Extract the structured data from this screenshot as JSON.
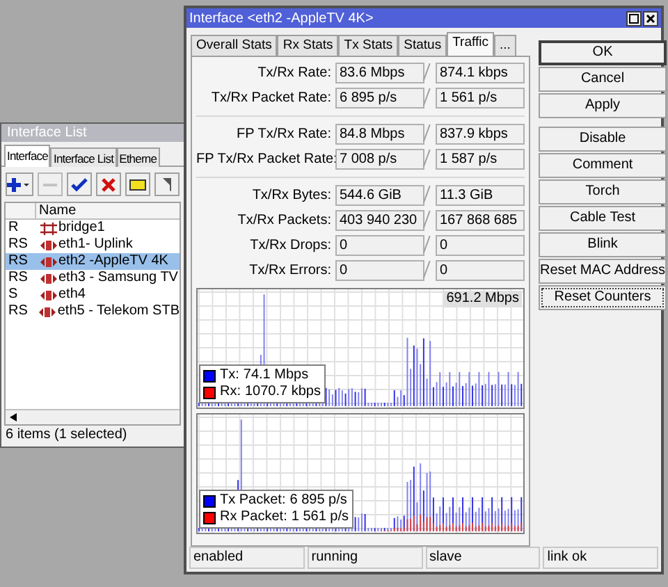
{
  "back_window": {
    "title": "Interface List",
    "tabs": [
      {
        "label": "Interface",
        "selected": true
      },
      {
        "label": "Interface List",
        "selected": false
      },
      {
        "label": "Etherne",
        "selected": false
      }
    ],
    "toolbar": [
      {
        "kind": "add",
        "disabled": false
      },
      {
        "kind": "remove",
        "disabled": true
      },
      {
        "kind": "enable",
        "disabled": false
      },
      {
        "kind": "disable",
        "disabled": false
      },
      {
        "kind": "comment",
        "disabled": false
      },
      {
        "kind": "filter",
        "disabled": false
      }
    ],
    "table": {
      "columns": {
        "name": "Name"
      },
      "rows": [
        {
          "flags": "R",
          "kind": "bridge",
          "name": "bridge1",
          "selected": false
        },
        {
          "flags": "RS",
          "kind": "ethernet",
          "name": "eth1- Uplink",
          "selected": false
        },
        {
          "flags": "RS",
          "kind": "ethernet",
          "name": "eth2 -AppleTV 4K",
          "selected": true
        },
        {
          "flags": "RS",
          "kind": "ethernet",
          "name": "eth3 - Samsung TV",
          "selected": false
        },
        {
          "flags": "S",
          "kind": "ethernet",
          "name": "eth4",
          "selected": false
        },
        {
          "flags": "RS",
          "kind": "ethernet",
          "name": "eth5 - Telekom STB",
          "selected": false
        }
      ]
    },
    "status_bar": "6 items (1 selected)"
  },
  "window": {
    "title": "Interface <eth2 -AppleTV 4K>",
    "tabs": [
      {
        "label": "Overall Stats",
        "selected": false
      },
      {
        "label": "Rx Stats",
        "selected": false
      },
      {
        "label": "Tx Stats",
        "selected": false
      },
      {
        "label": "Status",
        "selected": false
      },
      {
        "label": "Traffic",
        "selected": true
      },
      {
        "label": "...",
        "selected": false
      }
    ],
    "stat_groups": [
      [
        {
          "label": "Tx/Rx Rate:",
          "tx": "83.6 Mbps",
          "rx": "874.1 kbps"
        },
        {
          "label": "Tx/Rx Packet Rate:",
          "tx": "6 895 p/s",
          "rx": "1 561 p/s"
        }
      ],
      [
        {
          "label": "FP Tx/Rx Rate:",
          "tx": "84.8 Mbps",
          "rx": "837.9 kbps"
        },
        {
          "label": "FP Tx/Rx Packet Rate:",
          "tx": "7 008 p/s",
          "rx": "1 587 p/s"
        }
      ],
      [
        {
          "label": "Tx/Rx Bytes:",
          "tx": "544.6 GiB",
          "rx": "11.3 GiB"
        },
        {
          "label": "Tx/Rx Packets:",
          "tx": "403 940 230",
          "rx": "167 868 685"
        },
        {
          "label": "Tx/Rx Drops:",
          "tx": "0",
          "rx": "0"
        },
        {
          "label": "Tx/Rx Errors:",
          "tx": "0",
          "rx": "0"
        }
      ]
    ],
    "graphs": [
      {
        "max_label": "691.2 Mbps",
        "legend": [
          {
            "label": "Tx:",
            "value": "74.1 Mbps",
            "color": "#0000ff"
          },
          {
            "label": "Rx:",
            "value": "1070.7 kbps",
            "color": "#ff0000"
          }
        ]
      },
      {
        "legend": [
          {
            "label": "Tx Packet:",
            "value": "6 895 p/s",
            "color": "#0000ff"
          },
          {
            "label": "Rx Packet:",
            "value": "1 561 p/s",
            "color": "#ff0000"
          }
        ]
      }
    ],
    "button_groups": [
      [
        {
          "label": "OK",
          "default": true,
          "focused": false
        },
        {
          "label": "Cancel",
          "default": false,
          "focused": false
        },
        {
          "label": "Apply",
          "default": false,
          "focused": false
        }
      ],
      [
        {
          "label": "Disable",
          "default": false,
          "focused": false
        },
        {
          "label": "Comment",
          "default": false,
          "focused": false
        },
        {
          "label": "Torch",
          "default": false,
          "focused": false
        },
        {
          "label": "Cable Test",
          "default": false,
          "focused": false
        },
        {
          "label": "Blink",
          "default": false,
          "focused": false
        },
        {
          "label": "Reset MAC Address",
          "default": false,
          "focused": false
        },
        {
          "label": "Reset Counters",
          "default": false,
          "focused": true
        }
      ]
    ],
    "status_bar": [
      "enabled",
      "running",
      "slave",
      "link ok"
    ]
  }
}
